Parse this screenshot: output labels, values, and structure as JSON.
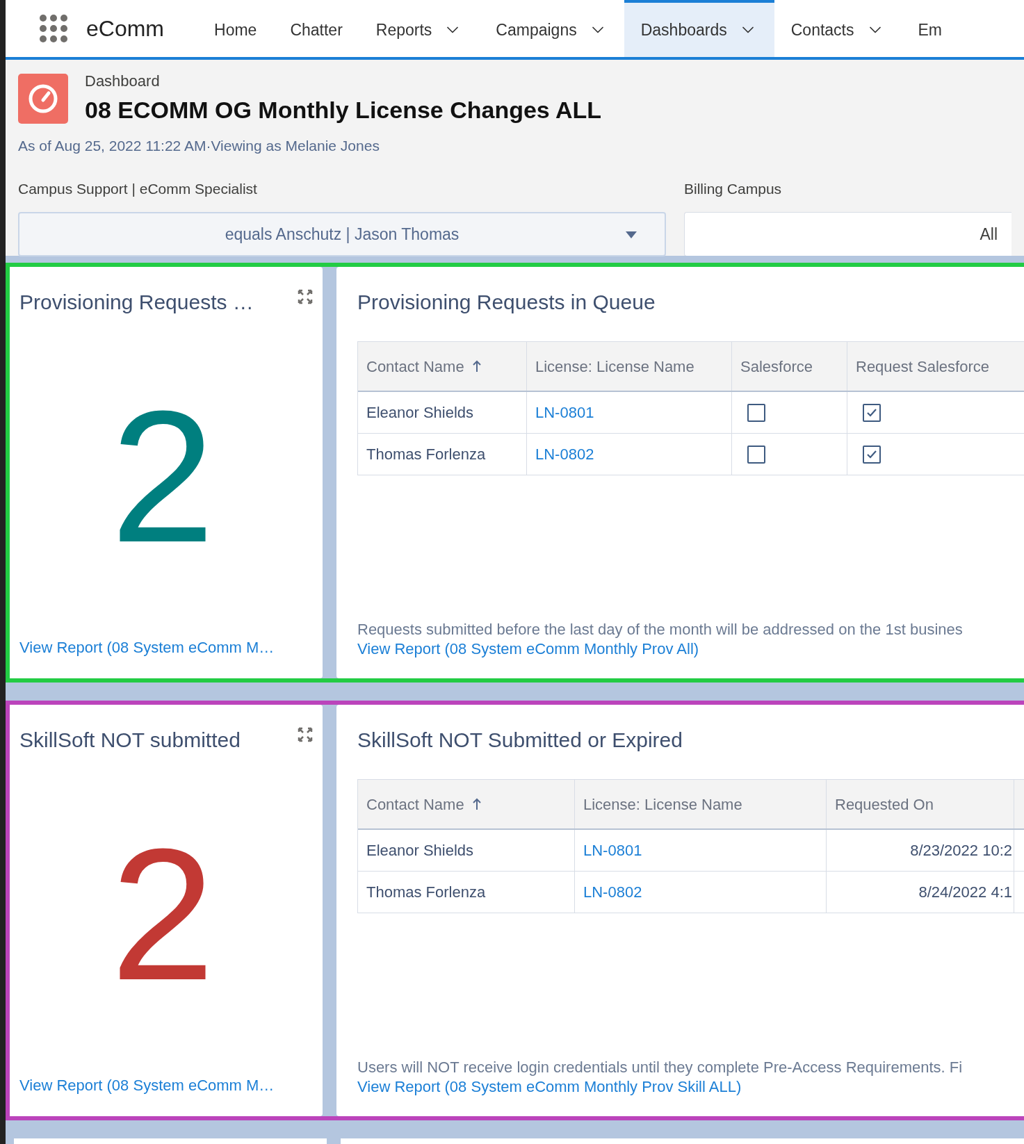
{
  "app": {
    "name": "eComm"
  },
  "nav": [
    {
      "label": "Home",
      "dropdown": false,
      "selected": false
    },
    {
      "label": "Chatter",
      "dropdown": false,
      "selected": false
    },
    {
      "label": "Reports",
      "dropdown": true,
      "selected": false
    },
    {
      "label": "Campaigns",
      "dropdown": true,
      "selected": false
    },
    {
      "label": "Dashboards",
      "dropdown": true,
      "selected": true
    },
    {
      "label": "Contacts",
      "dropdown": true,
      "selected": false
    },
    {
      "label": "Em",
      "dropdown": false,
      "selected": false
    }
  ],
  "header": {
    "type_label": "Dashboard",
    "title": "08 ECOMM OG Monthly License Changes ALL",
    "subtitle": "As of Aug 25, 2022 11:22 AM·Viewing as Melanie Jones"
  },
  "filters": [
    {
      "label": "Campus Support | eComm Specialist",
      "value": "equals Anschutz | Jason Thomas",
      "dropdown": true
    },
    {
      "label": "Billing Campus",
      "value": "All",
      "dropdown": false
    }
  ],
  "sections": [
    {
      "color": "#22cc44",
      "metric": {
        "title": "Provisioning Requests …",
        "value": "2",
        "color": "#007f7f",
        "link": "View Report (08 System eComm M…"
      },
      "table": {
        "title": "Provisioning Requests in Queue",
        "columns": [
          {
            "label": "Contact Name",
            "sorted": true
          },
          {
            "label": "License: License Name",
            "sorted": false
          },
          {
            "label": "Salesforce",
            "sorted": false
          },
          {
            "label": "Request Salesforce",
            "sorted": false
          }
        ],
        "rows": [
          [
            {
              "kind": "text",
              "text": "Eleanor Shields"
            },
            {
              "kind": "link",
              "text": "LN-0801"
            },
            {
              "kind": "checkbox",
              "checked": false
            },
            {
              "kind": "checkbox",
              "checked": true
            }
          ],
          [
            {
              "kind": "text",
              "text": "Thomas Forlenza"
            },
            {
              "kind": "link",
              "text": "LN-0802"
            },
            {
              "kind": "checkbox",
              "checked": false
            },
            {
              "kind": "checkbox",
              "checked": true
            }
          ]
        ],
        "footer": "Requests submitted before the last day of the month will be addressed on the 1st busines",
        "link": "View Report (08 System eComm Monthly Prov All)"
      }
    },
    {
      "color": "#bb44bb",
      "metric": {
        "title": "SkillSoft NOT submitted",
        "value": "2",
        "color": "#c23934",
        "link": "View Report (08 System eComm M…"
      },
      "table": {
        "title": "SkillSoft NOT Submitted or Expired",
        "columns": [
          {
            "label": "Contact Name",
            "sorted": true
          },
          {
            "label": "License: License Name",
            "sorted": false
          },
          {
            "label": "Requested On",
            "sorted": false
          }
        ],
        "rows": [
          [
            {
              "kind": "text",
              "text": "Eleanor Shields"
            },
            {
              "kind": "link",
              "text": "LN-0801"
            },
            {
              "kind": "date",
              "text": "8/23/2022 10:2"
            }
          ],
          [
            {
              "kind": "text",
              "text": "Thomas Forlenza"
            },
            {
              "kind": "link",
              "text": "LN-0802"
            },
            {
              "kind": "date",
              "text": "8/24/2022 4:1"
            }
          ]
        ],
        "footer": "Users will NOT receive login credentials until they complete Pre-Access Requirements. Fi",
        "link": "View Report (08 System eComm Monthly Prov Skill ALL)"
      }
    }
  ]
}
